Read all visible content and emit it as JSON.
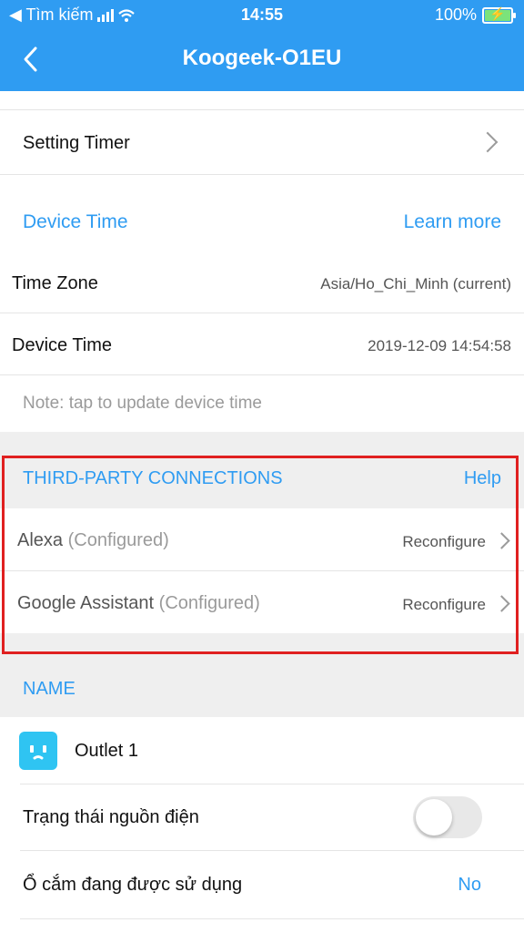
{
  "status_bar": {
    "back_app": "◀ Tìm kiếm",
    "time": "14:55",
    "battery": "100%"
  },
  "nav": {
    "title": "Koogeek-O1EU"
  },
  "setting_timer": {
    "label": "Setting Timer"
  },
  "device_time_section": {
    "title": "Device Time",
    "learn_more": "Learn more"
  },
  "time_zone": {
    "label": "Time Zone",
    "value": "Asia/Ho_Chi_Minh (current)"
  },
  "device_time": {
    "label": "Device Time",
    "value": "2019-12-09 14:54:58"
  },
  "note": "Note: tap to update device time",
  "third_party": {
    "title": "THIRD-PARTY CONNECTIONS",
    "help": "Help",
    "items": [
      {
        "name": "Alexa",
        "status": "(Configured)",
        "action": "Reconfigure"
      },
      {
        "name": "Google Assistant",
        "status": "(Configured)",
        "action": "Reconfigure"
      }
    ]
  },
  "name_section": {
    "title": "NAME"
  },
  "outlet": {
    "label": "Outlet 1"
  },
  "power_state": {
    "label": "Trạng thái nguồn điện",
    "on": false
  },
  "in_use": {
    "label": "Ổ cắm đang được sử dụng",
    "value": "No"
  },
  "colors": {
    "accent": "#2f9cf2",
    "highlight": "#e02020"
  }
}
